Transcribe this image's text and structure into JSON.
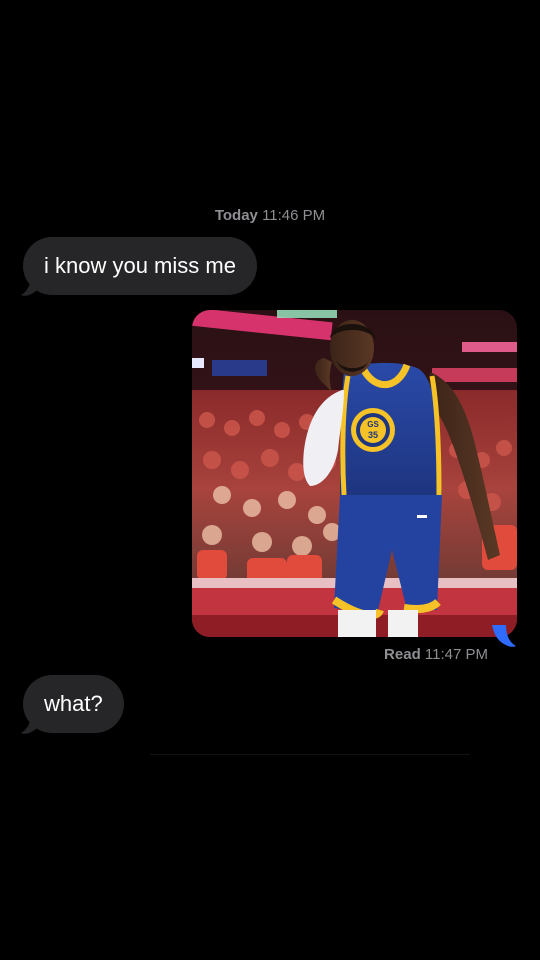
{
  "conversation": {
    "timestamp_day": "Today",
    "timestamp_time": "11:46 PM",
    "messages": [
      {
        "direction": "incoming",
        "text": "i know you miss me"
      },
      {
        "direction": "outgoing",
        "type": "photo",
        "jersey_team": "GOLDEN STATE WARRIORS",
        "jersey_number": "35"
      },
      {
        "direction": "incoming",
        "text": "what?"
      }
    ],
    "read_label": "Read",
    "read_time": "11:47 PM"
  },
  "colors": {
    "background": "#000000",
    "incoming_bubble": "#262628",
    "outgoing_accent": "#2f6bff",
    "meta_text": "#8e8e93"
  }
}
